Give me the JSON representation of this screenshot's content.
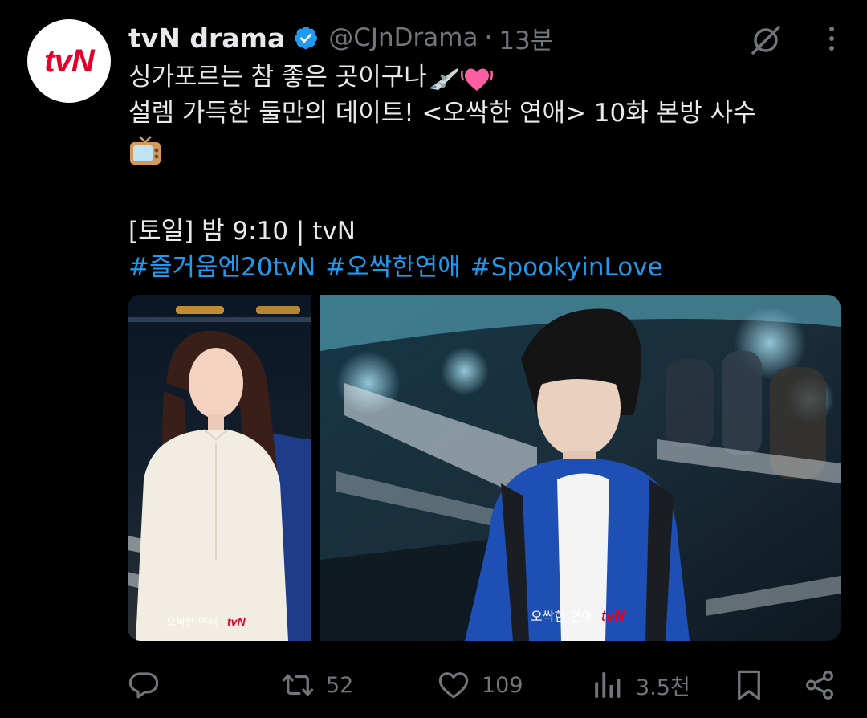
{
  "account": {
    "avatar_text": "tvN",
    "name": "tvN drama",
    "handle": "@CJnDrama",
    "separator": "·",
    "time": "13분"
  },
  "tweet": {
    "line1_text": "싱가포르는 참 좋은 곳이구나",
    "line2_text": "설렘 가득한 둘만의 데이트!  <오싹한 연애> 10화 본방 사수",
    "schedule": "[토일] 밤 9:10 | tvN",
    "hashtags": [
      "#즐거움엔20tvN",
      "#오싹한연애",
      "#SpookyinLove"
    ]
  },
  "media": {
    "left_caption": "오싹한 연애",
    "left_logo": "tvN",
    "right_caption": "오싹한 연애",
    "right_logo": "tvN"
  },
  "actions": {
    "reply_count": "",
    "retweet_count": "52",
    "like_count": "109",
    "views_count": "3.5천"
  },
  "colors": {
    "background": "#000000",
    "text": "#e7e9ea",
    "secondary": "#71767b",
    "link": "#1d9bf0",
    "verified": "#1d9bf0",
    "brand": "#e4002b"
  },
  "icons": {
    "verified": "verified-badge-icon",
    "grok": "grok-icon",
    "more": "more-dots-icon",
    "airplane_emoji": "airplane-emoji",
    "heart_emoji": "beating-heart-emoji",
    "tv_emoji": "television-emoji",
    "reply": "reply-icon",
    "retweet": "retweet-icon",
    "like": "heart-icon",
    "views": "views-icon",
    "bookmark": "bookmark-icon",
    "share": "share-icon"
  }
}
